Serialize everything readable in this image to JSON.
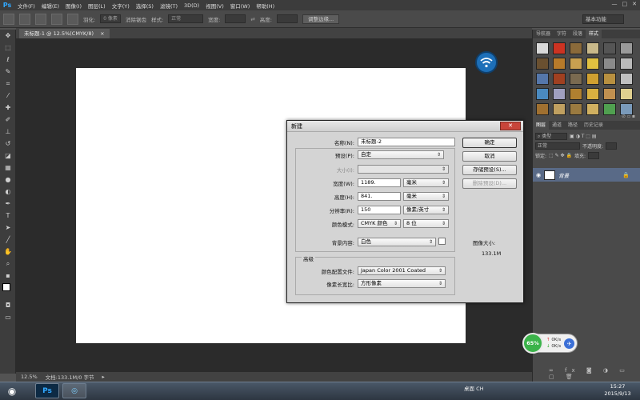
{
  "menubar": {
    "logo": "Ps",
    "items": [
      "文件(F)",
      "编辑(E)",
      "图像(I)",
      "图层(L)",
      "文字(Y)",
      "选择(S)",
      "滤镜(T)",
      "3D(D)",
      "视图(V)",
      "窗口(W)",
      "帮助(H)"
    ],
    "controls": [
      "—",
      "□",
      "✕"
    ]
  },
  "options_bar": {
    "feather_label": "羽化:",
    "feather_value": "0 像素",
    "antialias_label": "消除锯齿",
    "style_label": "样式:",
    "style_value": "正常",
    "width_label": "宽度:",
    "height_label": "高度:",
    "refine_edge_button": "调整边缘...",
    "workspace": "基本功能"
  },
  "document": {
    "tab_title": "未标题-1 @ 12.5%(CMYK/8)",
    "tab_close": "×"
  },
  "status_bar": {
    "zoom": "12.5%",
    "doc_info": "文档:133.1M/0 字节"
  },
  "right_panel": {
    "top_tabs": [
      "导航器",
      "字符",
      "段落",
      "样式"
    ],
    "layer_tabs": [
      "图层",
      "通道",
      "路径",
      "历史记录"
    ],
    "filter_label": "类型",
    "blend_mode": "正常",
    "opacity_label": "不透明度:",
    "lock_label": "锁定:",
    "fill_label": "填充:",
    "layer_name": "背景",
    "swatch_colors": [
      "#d9d9d9",
      "#cc3322",
      "#8a6a3a",
      "#c9b98a",
      "#555555",
      "#9a9a9a",
      "#6a5030",
      "#b77a2a",
      "#c8a050",
      "#e0c040",
      "#8a8a8a",
      "#bbbbbb",
      "#5577aa",
      "#a04020",
      "#7a6a50",
      "#d0a030",
      "#b89040",
      "#c0c0c0",
      "#4a8ac0",
      "#a0a0c0",
      "#b08030",
      "#d8b040",
      "#c09050",
      "#e0d090",
      "#a07030",
      "#c0a060",
      "#9a7a40",
      "#d0b060",
      "#50a050",
      "#7a9aba"
    ]
  },
  "network_widget": {
    "percent": "65%",
    "up": "0K/s",
    "down": "0K/s"
  },
  "taskbar": {
    "start": "◉",
    "apps": [
      "Ps",
      "◎"
    ],
    "tray_text": "桌面   CH",
    "time": "15:27",
    "date": "2015/9/13"
  },
  "dialog": {
    "title": "新建",
    "close": "✕",
    "name_label": "名称(N):",
    "name_value": "未标题-2",
    "preset_label": "预设(P):",
    "preset_value": "自定",
    "size_label": "大小(I):",
    "width_label": "宽度(W):",
    "width_value": "1189.",
    "width_unit": "毫米",
    "height_label": "高度(H):",
    "height_value": "841.",
    "height_unit": "毫米",
    "resolution_label": "分辨率(R):",
    "resolution_value": "150",
    "resolution_unit": "像素/英寸",
    "color_mode_label": "颜色模式:",
    "color_mode_value": "CMYK 颜色",
    "bit_depth": "8 位",
    "bg_label": "背景内容:",
    "bg_value": "白色",
    "advanced_label": "高级",
    "profile_label": "颜色配置文件:",
    "profile_value": "Japan Color 2001 Coated",
    "aspect_label": "像素长宽比:",
    "aspect_value": "方形像素",
    "ok_button": "确定",
    "cancel_button": "取消",
    "save_preset_button": "存储预设(S)...",
    "delete_preset_button": "删除预设(D)...",
    "image_size_label": "图像大小:",
    "image_size_value": "133.1M"
  }
}
